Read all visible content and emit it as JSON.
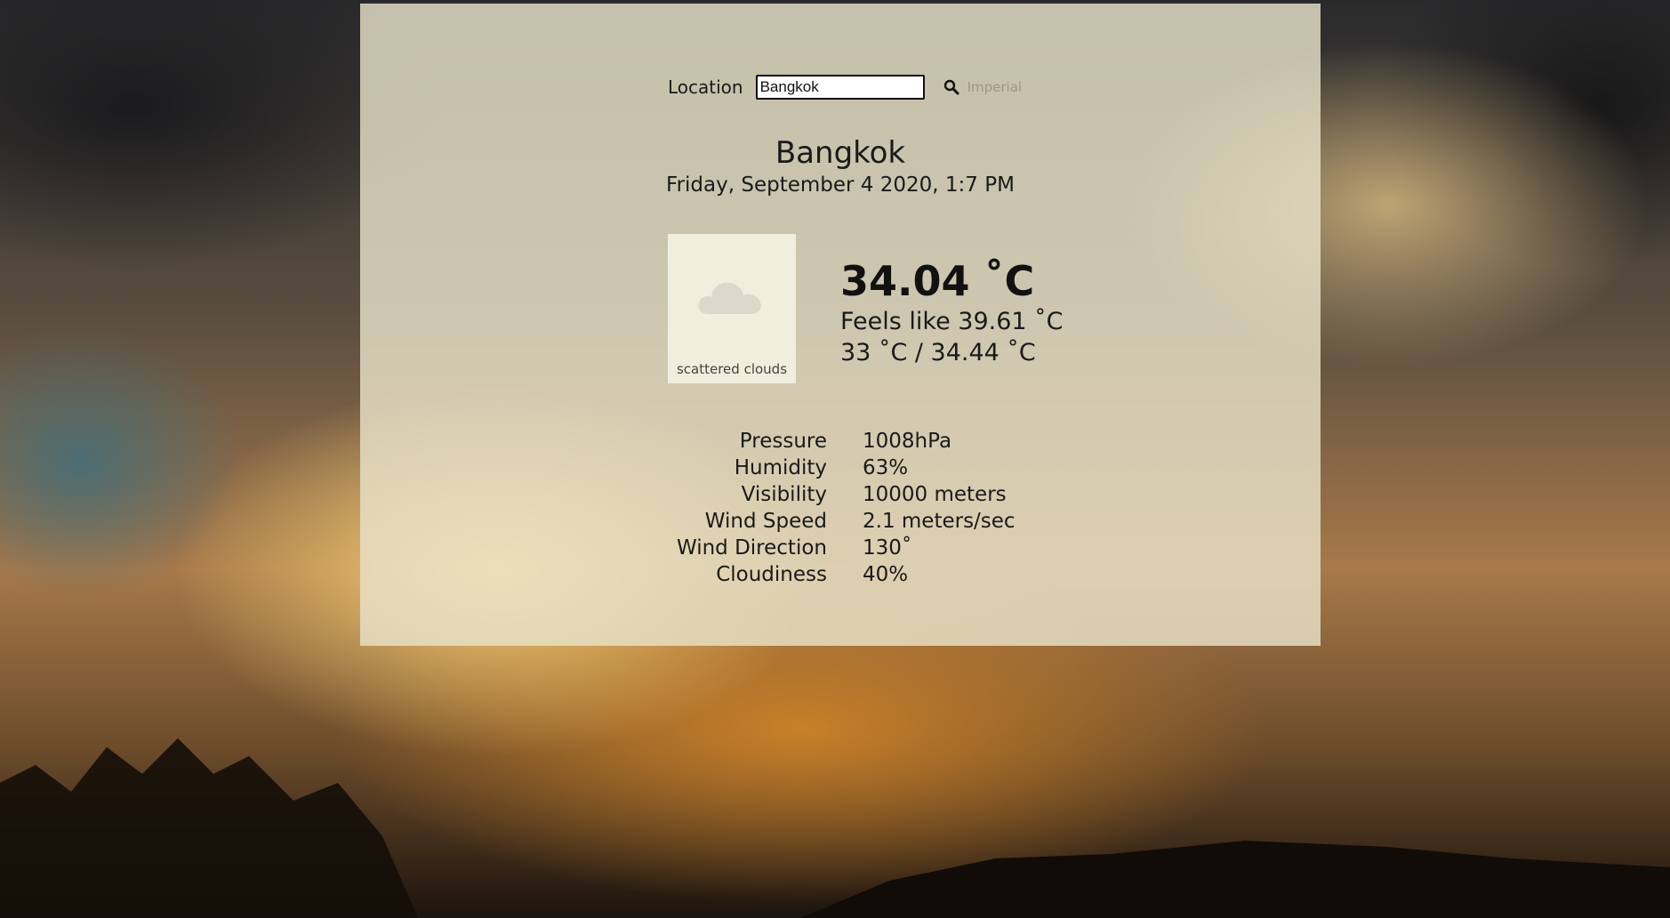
{
  "search": {
    "label": "Location",
    "value": "Bangkok",
    "units_toggle": "Imperial"
  },
  "location": {
    "city": "Bangkok",
    "datetime": "Friday, September 4 2020, 1:7 PM"
  },
  "current": {
    "icon": "cloud-icon",
    "description": "scattered clouds",
    "temperature": "34.04 ˚C",
    "feels_like": "Feels like 39.61 ˚C",
    "min_max": "33 ˚C / 34.44 ˚C"
  },
  "details": [
    {
      "label": "Pressure",
      "value": "1008hPa"
    },
    {
      "label": "Humidity",
      "value": "63%"
    },
    {
      "label": "Visibility",
      "value": "10000 meters"
    },
    {
      "label": "Wind Speed",
      "value": "2.1 meters/sec"
    },
    {
      "label": "Wind Direction",
      "value": "130˚"
    },
    {
      "label": "Cloudiness",
      "value": "40%"
    }
  ],
  "colors": {
    "panel": "#e8e2c8",
    "text": "#1a1a1a",
    "muted_link": "#9a9588"
  }
}
